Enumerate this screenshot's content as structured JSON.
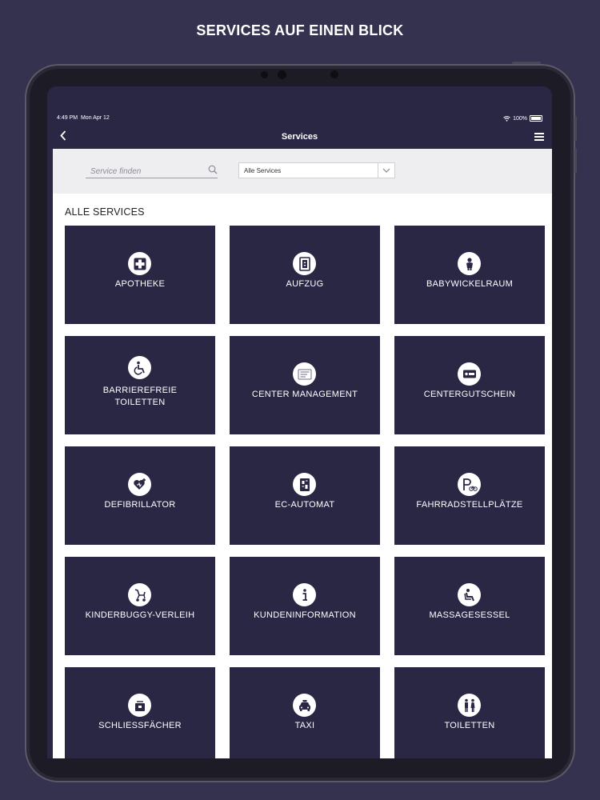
{
  "promo": {
    "title": "SERVICES AUF EINEN BLICK"
  },
  "status_bar": {
    "time": "4:49 PM",
    "date": "Mon Apr 12",
    "battery": "100%"
  },
  "nav": {
    "title": "Services",
    "back_icon": "chevron-left-icon",
    "menu_icon": "hamburger-menu-icon"
  },
  "filter": {
    "search_placeholder": "Service finden",
    "category_value": "Alle Services"
  },
  "section": {
    "title": "ALLE SERVICES"
  },
  "services": [
    {
      "label": "APOTHEKE",
      "icon": "pharmacy-cross-icon"
    },
    {
      "label": "AUFZUG",
      "icon": "elevator-icon"
    },
    {
      "label": "BABYWICKELRAUM",
      "icon": "baby-changing-icon"
    },
    {
      "label": "BARRIEREFREIE TOILETTEN",
      "icon": "wheelchair-icon"
    },
    {
      "label": "CENTER MANAGEMENT",
      "icon": "document-icon"
    },
    {
      "label": "CENTERGUTSCHEIN",
      "icon": "gift-card-icon"
    },
    {
      "label": "DEFIBRILLATOR",
      "icon": "heart-defibrillator-icon"
    },
    {
      "label": "EC-AUTOMAT",
      "icon": "atm-icon"
    },
    {
      "label": "FAHRRADSTELLPLÄTZE",
      "icon": "bicycle-parking-icon"
    },
    {
      "label": "KINDERBUGGY-VERLEIH",
      "icon": "stroller-icon"
    },
    {
      "label": "KUNDENINFORMATION",
      "icon": "info-icon"
    },
    {
      "label": "MASSAGESESSEL",
      "icon": "massage-chair-icon"
    },
    {
      "label": "SCHLIESSFÄCHER",
      "icon": "locker-icon"
    },
    {
      "label": "TAXI",
      "icon": "taxi-icon"
    },
    {
      "label": "TOILETTEN",
      "icon": "restroom-icon"
    }
  ],
  "colors": {
    "background": "#35324f",
    "tile": "#2a2745",
    "filter_bar": "#eeeef0"
  }
}
